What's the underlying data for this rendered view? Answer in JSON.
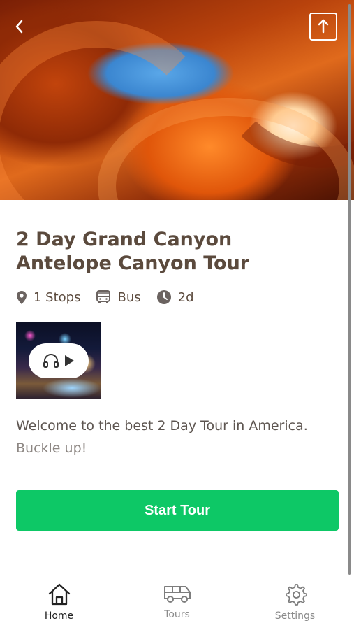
{
  "hero": {
    "image": "canyon-photo",
    "back_icon": "chevron-left-icon",
    "share_icon": "share-upload-icon"
  },
  "tour": {
    "title": "2 Day Grand Canyon Antelope Canyon Tour",
    "meta": [
      {
        "icon": "map-pin-icon",
        "label": "1 Stops"
      },
      {
        "icon": "bus-icon",
        "label": "Bus"
      },
      {
        "icon": "clock-icon",
        "label": "2d"
      }
    ],
    "description_line1": "Welcome to the best 2 Day Tour in America.",
    "description_line2": "Buckle up!"
  },
  "audio": {
    "headphones_icon": "headphones-icon",
    "play_icon": "play-icon"
  },
  "cta": {
    "label": "Start Tour",
    "color": "#0dc866"
  },
  "tabbar": {
    "items": [
      {
        "label": "Home",
        "icon": "home-icon",
        "active": true
      },
      {
        "label": "Tours",
        "icon": "van-icon",
        "active": false
      },
      {
        "label": "Settings",
        "icon": "gear-icon",
        "active": false
      }
    ]
  }
}
